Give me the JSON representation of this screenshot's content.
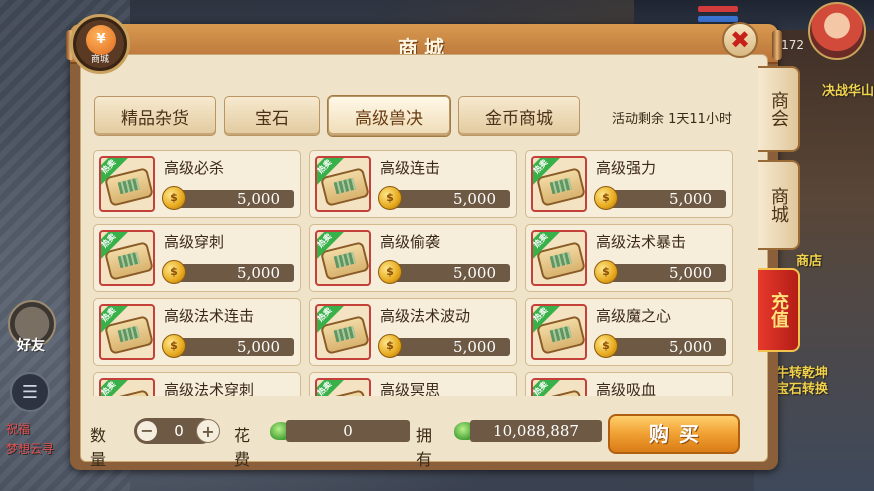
{
  "background": {
    "hud_level": "172",
    "right_labels": [
      "决战华山",
      "商店",
      "牛转乾坤",
      "宝石转换"
    ],
    "friend_label": "好友",
    "left_texts": [
      "祝福",
      "梦想云寻"
    ]
  },
  "shop": {
    "title": "商城",
    "emblem_symbol": "¥",
    "emblem_label": "商城",
    "close_symbol": "✖",
    "tabs": [
      {
        "label": "精品杂货",
        "active": false
      },
      {
        "label": "宝石",
        "active": false
      },
      {
        "label": "高级兽决",
        "active": true
      },
      {
        "label": "金币商城",
        "active": false
      }
    ],
    "timer": "活动剩余 1天11小时",
    "hot_badge": "热卖",
    "coin_symbol": "$",
    "items": [
      {
        "name": "高级必杀",
        "price": "5,000"
      },
      {
        "name": "高级连击",
        "price": "5,000"
      },
      {
        "name": "高级强力",
        "price": "5,000"
      },
      {
        "name": "高级穿刺",
        "price": "5,000"
      },
      {
        "name": "高级偷袭",
        "price": "5,000"
      },
      {
        "name": "高级法术暴击",
        "price": "5,000"
      },
      {
        "name": "高级法术连击",
        "price": "5,000"
      },
      {
        "name": "高级法术波动",
        "price": "5,000"
      },
      {
        "name": "高级魔之心",
        "price": "5,000"
      },
      {
        "name": "高级法术穿刺",
        "price": ""
      },
      {
        "name": "高级冥思",
        "price": ""
      },
      {
        "name": "高级吸血",
        "price": ""
      }
    ],
    "footer": {
      "quantity_label": "数量",
      "quantity_value": "0",
      "minus": "−",
      "plus": "+",
      "cost_label": "花费",
      "cost_value": "0",
      "own_label": "拥有",
      "own_value": "10,088,887",
      "buy_label": "购买"
    },
    "side_tabs": [
      {
        "label": "商会",
        "style": "normal"
      },
      {
        "label": "商城",
        "style": "normal"
      },
      {
        "label": "充值",
        "style": "hot"
      }
    ]
  },
  "colors": {
    "panel_frame": "#8a5f3a",
    "panel_bg": "#efe3c9",
    "icon_border": "#c4413a",
    "hot_badge": "#39b14a",
    "buy_button": "#f0a032",
    "recharge_tab": "#e8392c"
  }
}
